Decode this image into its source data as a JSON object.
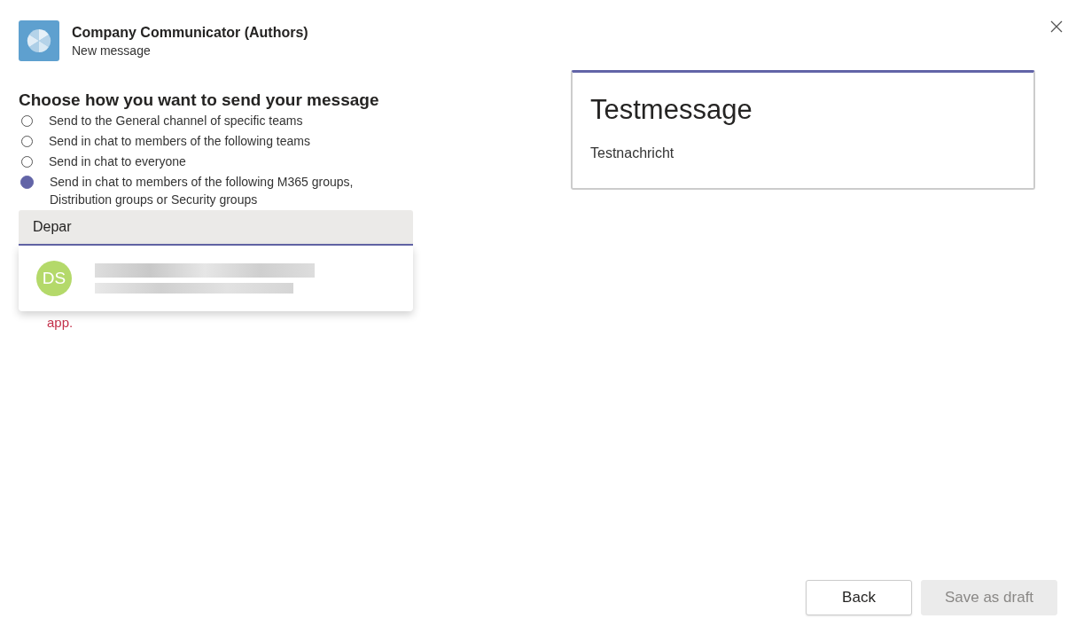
{
  "header": {
    "title": "Company Communicator (Authors)",
    "subtitle": "New message"
  },
  "section_title": "Choose how you want to send your message",
  "options": [
    {
      "label": "Send to the General channel of specific teams",
      "selected": false
    },
    {
      "label": "Send in chat to members of the following teams",
      "selected": false
    },
    {
      "label": "Send in chat to everyone",
      "selected": false
    },
    {
      "label": "Send in chat to members of the following M365 groups, Distribution groups or Security groups",
      "selected": true
    }
  ],
  "search": {
    "value": "Depar"
  },
  "suggestions": [
    {
      "initials": "DS",
      "color": "#b4d96a"
    }
  ],
  "error_text": "app.",
  "preview": {
    "title": "Testmessage",
    "body": "Testnachricht"
  },
  "buttons": [
    {
      "label": "Back",
      "disabled": false
    },
    {
      "label": "Save as draft",
      "disabled": true
    }
  ]
}
